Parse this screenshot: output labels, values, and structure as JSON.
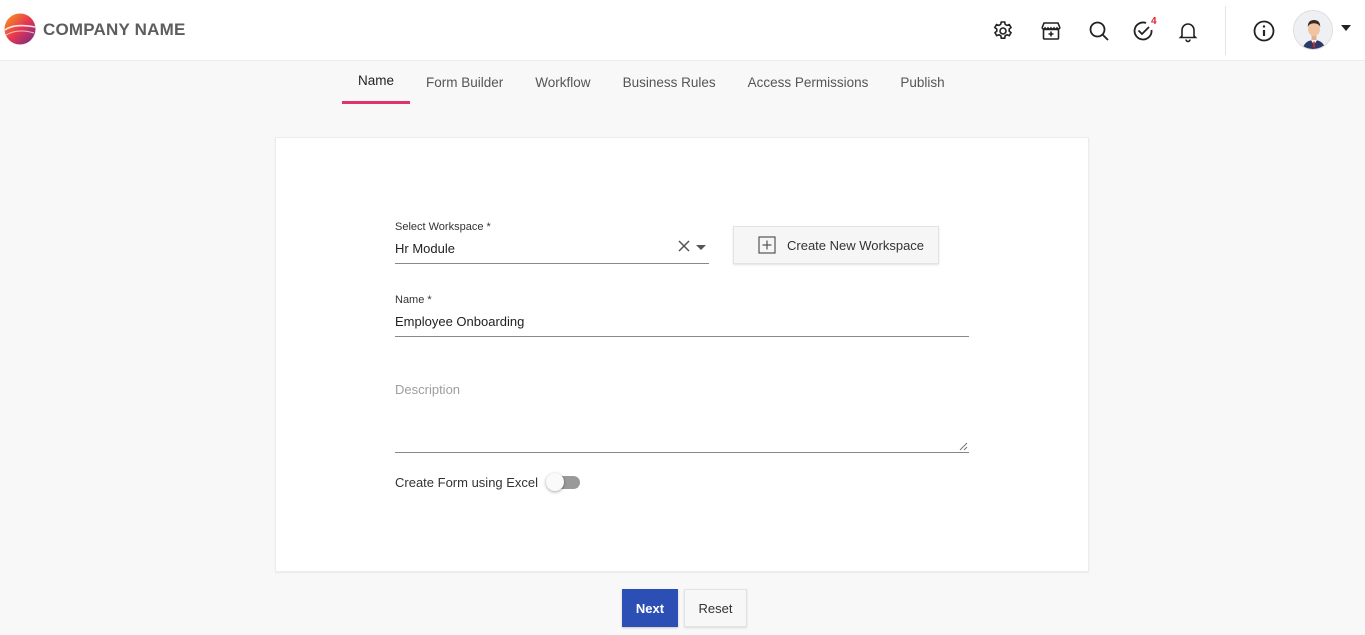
{
  "header": {
    "brand": "COMPANY NAME",
    "notification_badge": "4",
    "icons": [
      "settings-gear-icon",
      "store-add-icon",
      "search-icon",
      "tasks-check-icon",
      "bell-icon",
      "info-icon"
    ]
  },
  "tabs": [
    {
      "label": "Name",
      "active": true
    },
    {
      "label": "Form Builder",
      "active": false
    },
    {
      "label": "Workflow",
      "active": false
    },
    {
      "label": "Business Rules",
      "active": false
    },
    {
      "label": "Access Permissions",
      "active": false
    },
    {
      "label": "Publish",
      "active": false
    }
  ],
  "form": {
    "workspace_label": "Select Workspace *",
    "workspace_value": "Hr Module",
    "create_workspace_label": "Create New Workspace",
    "name_label": "Name *",
    "name_value": "Employee Onboarding",
    "description_placeholder": "Description",
    "excel_toggle_label": "Create Form using Excel",
    "excel_toggle_on": false
  },
  "actions": {
    "next_label": "Next",
    "reset_label": "Reset"
  },
  "colors": {
    "accent": "#e0336b",
    "primary_button": "#2c4fb5",
    "badge": "#e0202a"
  }
}
